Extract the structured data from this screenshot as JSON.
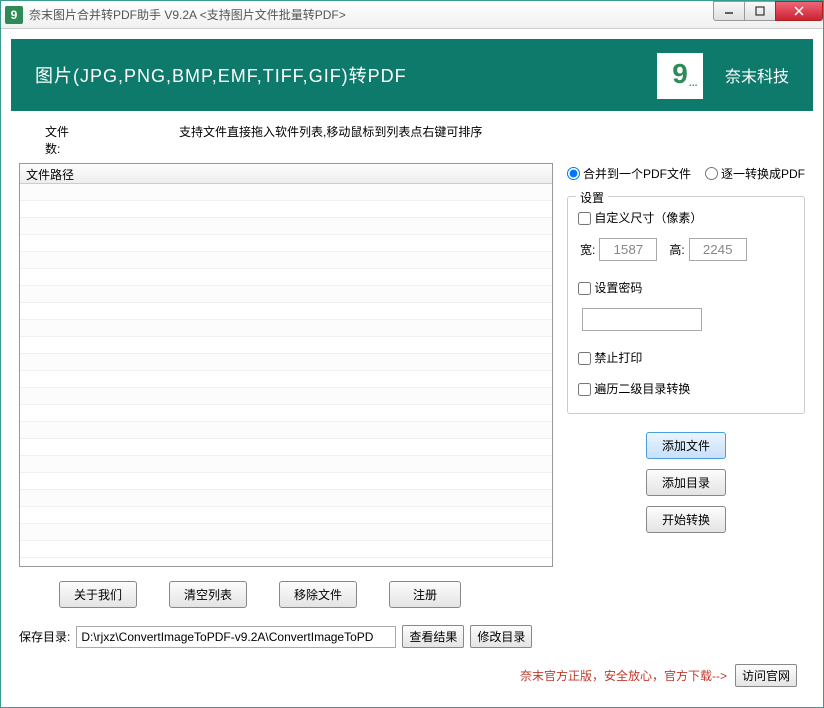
{
  "titlebar": {
    "icon_text": "9",
    "title": "奈末图片合并转PDF助手 V9.2A  <支持图片文件批量转PDF>"
  },
  "header": {
    "title": "图片(JPG,PNG,BMP,EMF,TIFF,GIF)转PDF",
    "logo_nine": "9",
    "logo_dots": "...",
    "brand": "奈末科技"
  },
  "info": {
    "file_count_label": "文件数:",
    "hint": "支持文件直接拖入软件列表,移动鼠标到列表点右键可排序"
  },
  "file_list": {
    "column_header": "文件路径"
  },
  "buttons": {
    "about": "关于我们",
    "clear": "清空列表",
    "remove": "移除文件",
    "register": "注册"
  },
  "radio": {
    "merge": "合并到一个PDF文件",
    "each": "逐一转换成PDF"
  },
  "settings": {
    "title": "设置",
    "custom_size": "自定义尺寸（像素）",
    "width_label": "宽:",
    "width_value": "1587",
    "height_label": "高:",
    "height_value": "2245",
    "set_password": "设置密码",
    "password_value": "",
    "no_print": "禁止打印",
    "traverse": "遍历二级目录转换"
  },
  "actions": {
    "add_file": "添加文件",
    "add_dir": "添加目录",
    "start": "开始转换"
  },
  "save": {
    "label": "保存目录:",
    "path": "D:\\rjxz\\ConvertImageToPDF-v9.2A\\ConvertImageToPD",
    "view_result": "查看结果",
    "change_dir": "修改目录"
  },
  "footer": {
    "text": "奈末官方正版，安全放心，官方下载-->",
    "visit": "访问官网"
  }
}
